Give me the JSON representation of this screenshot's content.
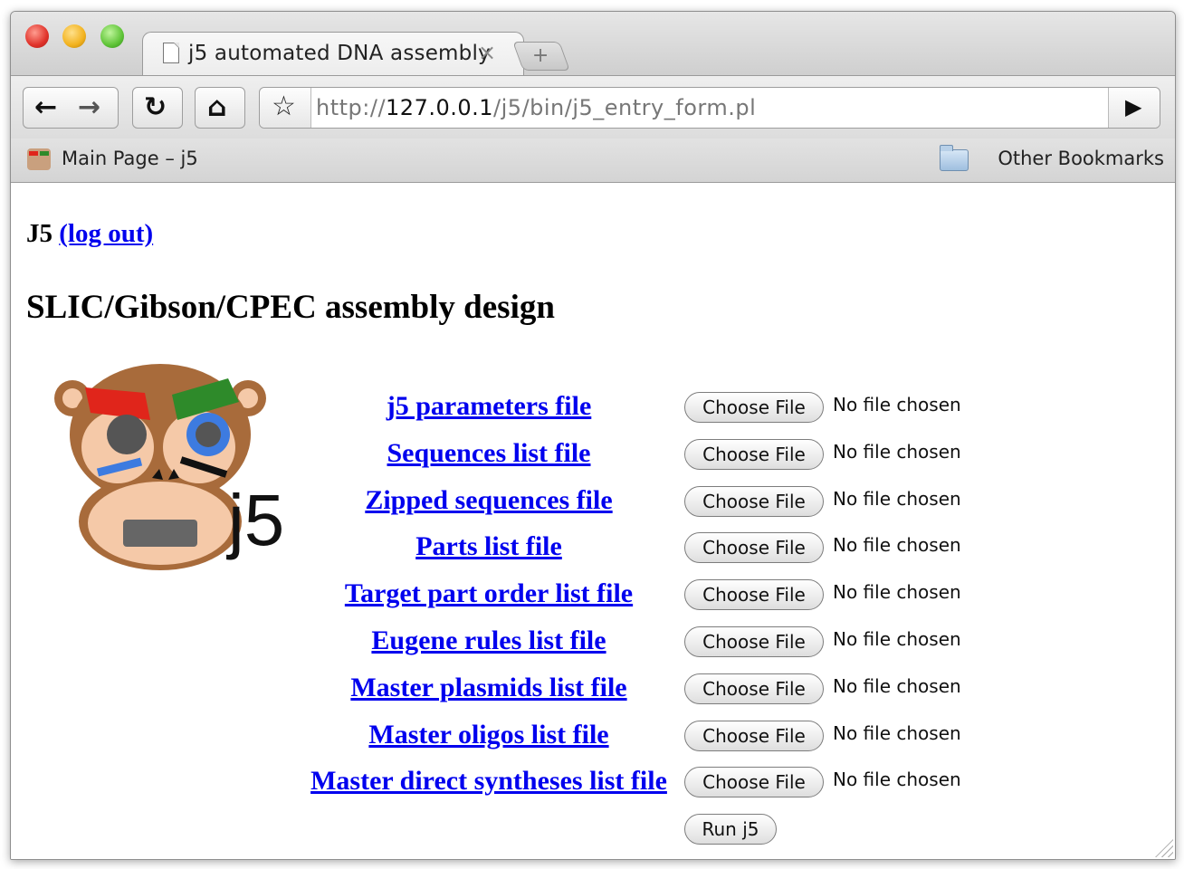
{
  "browser": {
    "tab_title": "j5 automated DNA assembly",
    "tab_close": "×",
    "new_tab": "+",
    "url_prefix": "http://",
    "url_host": "127.0.0.1",
    "url_path": "/j5/bin/j5_entry_form.pl",
    "bookmark_main": "Main Page – j5",
    "bookmark_other": "Other Bookmarks",
    "icons": [
      "back-icon",
      "forward-icon",
      "reload-icon",
      "home-icon",
      "star-icon",
      "go-icon",
      "folder-icon"
    ]
  },
  "page": {
    "header_prefix": "J5",
    "logout_label": "(log out)",
    "heading": "SLIC/Gibson/CPEC assembly design",
    "logo_text": "j5",
    "choose_label": "Choose File",
    "no_file_label": "No file chosen",
    "run_label": "Run j5",
    "files": [
      {
        "label": "j5 parameters file"
      },
      {
        "label": "Sequences list file"
      },
      {
        "label": "Zipped sequences file"
      },
      {
        "label": "Parts list file"
      },
      {
        "label": "Target part order list file"
      },
      {
        "label": "Eugene rules list file"
      },
      {
        "label": "Master plasmids list file"
      },
      {
        "label": "Master oligos list file"
      },
      {
        "label": "Master direct syntheses list file"
      }
    ]
  }
}
